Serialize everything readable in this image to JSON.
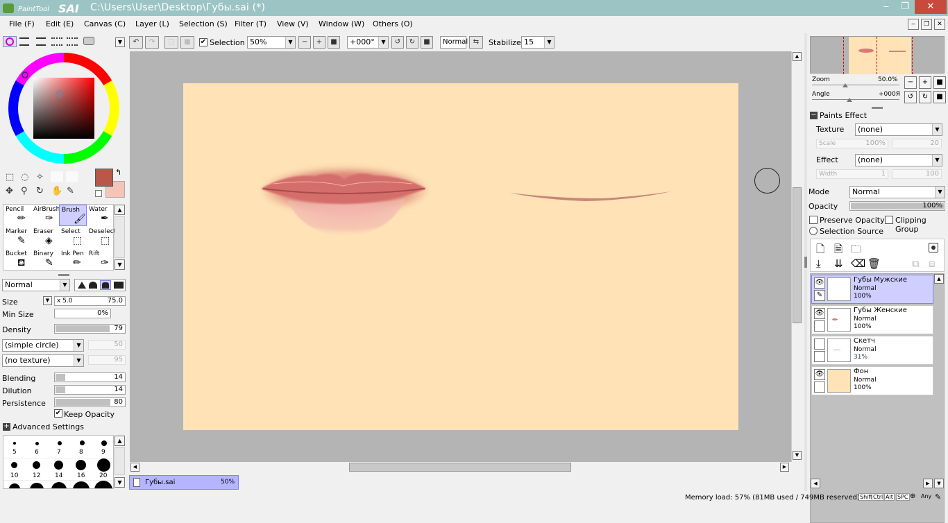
{
  "window": {
    "app_name": "PaintTool SAI",
    "title": "C:\\Users\\User\\Desktop\\Губы.sai (*)"
  },
  "menu": [
    "File (F)",
    "Edit (E)",
    "Canvas (C)",
    "Layer (L)",
    "Selection (S)",
    "Filter (T)",
    "View (V)",
    "Window (W)",
    "Others (O)"
  ],
  "toolbar": {
    "selection_label": "Selection",
    "selection_checked": true,
    "zoom": "50%",
    "angle": "+000°",
    "mode": "Normal",
    "stabilizer_label": "Stabilizer",
    "stabilizer": "15"
  },
  "colors": {
    "primary": "#b8574a",
    "secondary": "#f4c4b8",
    "paper": "#ffe2b6",
    "accent_selection": "#cfcfff"
  },
  "tools": [
    {
      "label": "Pencil"
    },
    {
      "label": "AirBrush"
    },
    {
      "label": "Brush"
    },
    {
      "label": "Water"
    },
    {
      "label": "Marker"
    },
    {
      "label": "Eraser"
    },
    {
      "label": "Select"
    },
    {
      "label": "Deselect"
    },
    {
      "label": "Bucket"
    },
    {
      "label": "Binary"
    },
    {
      "label": "Ink Pen"
    },
    {
      "label": "Rift"
    }
  ],
  "brush": {
    "blend_mode": "Normal",
    "size_label": "Size",
    "size_mult": "x 5.0",
    "size": "75.0",
    "min_size_label": "Min Size",
    "min_size": "0%",
    "density_label": "Density",
    "density": "79",
    "shape": "(simple circle)",
    "shape_val": "50",
    "texture": "(no texture)",
    "texture_val": "95",
    "blending_label": "Blending",
    "blending": "14",
    "dilution_label": "Dilution",
    "dilution": "14",
    "persistence_label": "Persistence",
    "persistence": "80",
    "keep_opacity_label": "Keep Opacity",
    "advanced_label": "Advanced Settings",
    "sizes_row1": [
      "5",
      "6",
      "7",
      "8",
      "9"
    ],
    "sizes_row2": [
      "10",
      "12",
      "14",
      "16",
      "20"
    ]
  },
  "tab": {
    "name": "Губы.sai",
    "zoom": "50%"
  },
  "navigator": {
    "zoom_label": "Zoom",
    "zoom": "50.0%",
    "angle_label": "Angle",
    "angle": "+000Я"
  },
  "paints_effect": {
    "title": "Paints Effect",
    "texture_label": "Texture",
    "texture": "(none)",
    "scale_label": "Scale",
    "scale": "100%",
    "scale2": "20",
    "effect_label": "Effect",
    "effect": "(none)",
    "width_label": "Width",
    "width": "1",
    "width2": "100"
  },
  "layer_props": {
    "mode_label": "Mode",
    "mode": "Normal",
    "opacity_label": "Opacity",
    "opacity": "100%",
    "preserve_label": "Preserve Opacity",
    "clipping_label": "Clipping Group",
    "source_label": "Selection Source"
  },
  "layers": [
    {
      "name": "Губы Мужские",
      "mode": "Normal",
      "opacity": "100%",
      "selected": true
    },
    {
      "name": "Губы Женские",
      "mode": "Normal",
      "opacity": "100%"
    },
    {
      "name": "Скетч",
      "mode": "Normal",
      "opacity": "31%"
    },
    {
      "name": "Фон",
      "mode": "Normal",
      "opacity": "100%"
    }
  ],
  "status": {
    "memory": "Memory load: 57% (81MB used / 749MB reserved)",
    "keys": [
      "Shift",
      "Ctrl",
      "Alt",
      "SPC",
      "Any"
    ]
  }
}
